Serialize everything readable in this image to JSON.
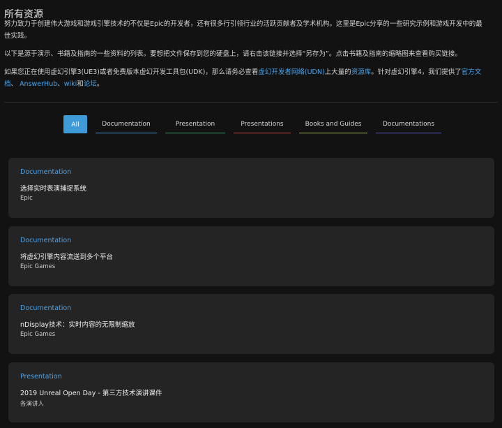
{
  "page": {
    "title": "所有资源"
  },
  "intro": {
    "p1": "努力致力于创建伟大游戏和游戏引擎技术的不仅是Epic的开发者，还有很多行引领行业的活跃贡献者及学术机构。这里是Epic分享的一些研究示例和游戏开发中的最佳实践。",
    "p2": "以下是源于演示、书籍及指南的一些资料的列表。要想把文件保存到您的硬盘上，请右击该链接并选择“另存为”。点击书籍及指南的缩略图来查看购买链接。",
    "p3_part1": "如果您正在使用虚幻引擎3(UE3)或者免费版本虚幻开发工具包(UDK)，那么请务必查看",
    "p3_link_udn": "虚幻开发者网络(UDN)",
    "p3_part2": "上大量的",
    "p3_link_library": "资源库",
    "p3_part3": "。针对虚幻引擎4，我们提供了",
    "p3_link_docs": "官方文档",
    "p3_sep1": "、",
    "p3_link_answerhub": "AnswerHub",
    "p3_sep2": "、",
    "p3_link_wiki": "wiki",
    "p3_and": "和",
    "p3_link_forum": "论坛",
    "p3_end": "。"
  },
  "tabs": {
    "all": "All",
    "documentation": "Documentation",
    "presentation": "Presentation",
    "presentations": "Presentations",
    "books": "Books and Guides",
    "documentations": "Documentations"
  },
  "cards": [
    {
      "category": "Documentation",
      "title": "选择实时表演捕捉系统",
      "author": "Epic"
    },
    {
      "category": "Documentation",
      "title": "将虚幻引擎内容流送到多个平台",
      "author": "Epic Games"
    },
    {
      "category": "Documentation",
      "title": "nDisplay技术：实时内容的无限制缩放",
      "author": "Epic Games"
    },
    {
      "category": "Presentation",
      "title": "2019 Unreal Open Day - 第三方技术演讲课件",
      "author": "各演讲人"
    }
  ],
  "colors": {
    "accent": "#4aa3ea",
    "tab_active_bg": "#3f9ad8",
    "tab_documentation": "#4a9fd8",
    "tab_presentation": "#3fa06b",
    "tab_presentations": "#d64545",
    "tab_books": "#a8c05a",
    "tab_documentations": "#5a5ad6"
  }
}
